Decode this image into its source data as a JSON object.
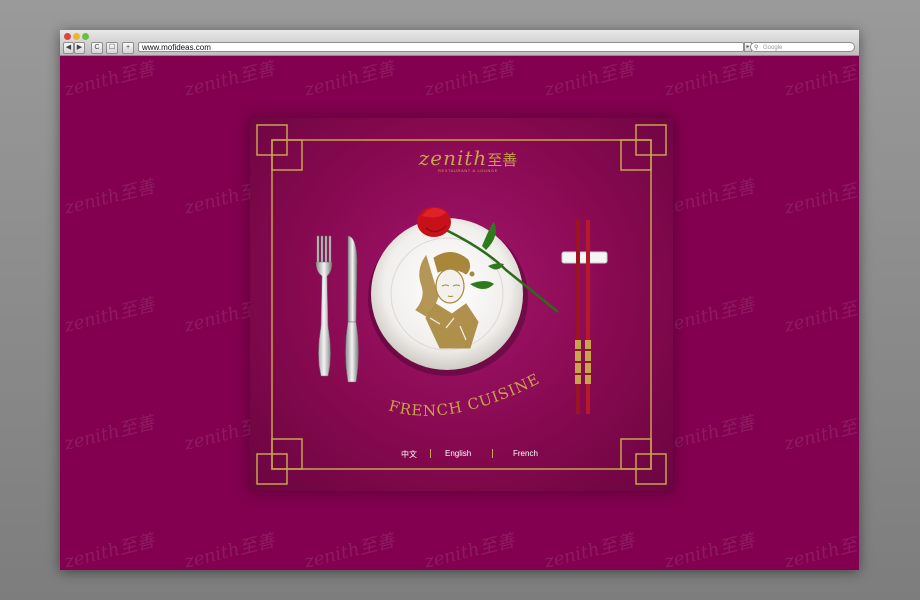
{
  "browser": {
    "url": "www.mofideas.com",
    "search_placeholder": "Google",
    "nav": {
      "back": "◀",
      "forward": "▶",
      "reload": "C",
      "bookmark": "☐",
      "add": "+"
    }
  },
  "site": {
    "logo_word": "zenith",
    "logo_han": "至善",
    "logo_tagline": "RESTAURANT & LOUNGE",
    "cuisine": "FRENCH CUISINE",
    "languages": [
      "中文",
      "English",
      "French"
    ]
  },
  "colors": {
    "background": "#82004f",
    "gold": "#c9a24d",
    "card": "#8e0c59"
  }
}
